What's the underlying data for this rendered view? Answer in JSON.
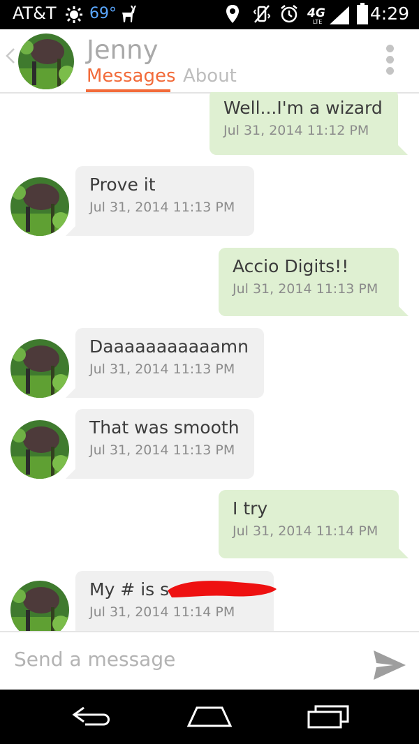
{
  "status_bar": {
    "carrier": "AT&T",
    "temperature": "69°",
    "time": "4:29",
    "network": "4G",
    "icons": [
      "weather-icon",
      "deer-icon",
      "location-icon",
      "vibrate-icon",
      "alarm-icon",
      "lte-icon",
      "signal-icon",
      "battery-icon"
    ]
  },
  "header": {
    "name": "Jenny",
    "tabs": [
      {
        "label": "Messages",
        "active": true
      },
      {
        "label": "About",
        "active": false
      }
    ],
    "accent_color": "#f26b3a"
  },
  "messages": [
    {
      "direction": "out",
      "text": "Well...I'm a wizard",
      "time": "Jul 31, 2014 11:12 PM"
    },
    {
      "direction": "in",
      "text": "Prove it",
      "time": "Jul 31, 2014 11:13 PM"
    },
    {
      "direction": "out",
      "text": "Accio Digits!!",
      "time": "Jul 31, 2014 11:13 PM"
    },
    {
      "direction": "in",
      "text": "Daaaaaaaaaaamn",
      "time": "Jul 31, 2014 11:13 PM"
    },
    {
      "direction": "in",
      "text": "That was smooth",
      "time": "Jul 31, 2014 11:13 PM"
    },
    {
      "direction": "out",
      "text": "I try",
      "time": "Jul 31, 2014 11:14 PM"
    },
    {
      "direction": "in",
      "text": "My # is s",
      "time": "Jul 31, 2014 11:14 PM",
      "redacted": true
    }
  ],
  "composer": {
    "placeholder": "Send a message"
  },
  "colors": {
    "outgoing_bubble": "#dff0d2",
    "incoming_bubble": "#f0f0f0",
    "redaction": "#ee1111"
  }
}
